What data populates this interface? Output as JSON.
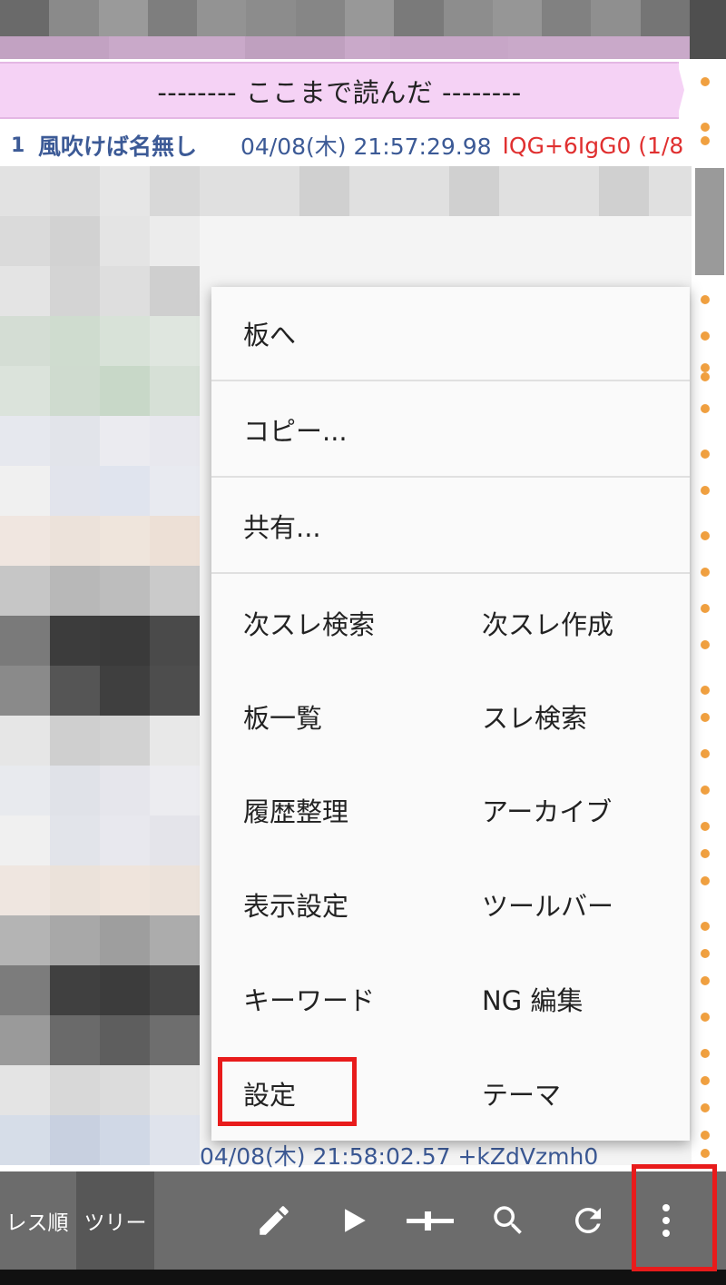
{
  "banner": {
    "text": "-------- ここまで読んだ --------"
  },
  "post": {
    "number": "1",
    "name": "風吹けば名無し",
    "date": "04/08(木) 21:57:29.98",
    "id": "IQG+6IgG0 (1/8"
  },
  "below_menu_line": "04/08(木) 21:58:02.57 +kZdVzmh0",
  "menu": {
    "items": [
      {
        "left": "板へ"
      },
      {
        "left": "コピー..."
      },
      {
        "left": "共有..."
      },
      {
        "left": "次スレ検索",
        "right": "次スレ作成"
      },
      {
        "left": "板一覧",
        "right": "スレ検索"
      },
      {
        "left": "履歴整理",
        "right": "アーカイブ"
      },
      {
        "left": "表示設定",
        "right": "ツールバー"
      },
      {
        "left": "キーワード",
        "right": "NG 編集"
      },
      {
        "left": "設定",
        "right": "テーマ"
      }
    ]
  },
  "toolbar": {
    "tab_res_order": "レス順",
    "tab_tree": "ツリー",
    "icons": [
      "pencil-icon",
      "play-icon",
      "slider-icon",
      "search-icon",
      "refresh-icon",
      "more-vert-icon"
    ]
  },
  "colors": {
    "banner_bg": "#f5d2f5",
    "post_link": "#3c5a96",
    "post_id": "#e03030",
    "toolbar_bg": "#6c6c6c",
    "highlight": "#e81b1b"
  }
}
